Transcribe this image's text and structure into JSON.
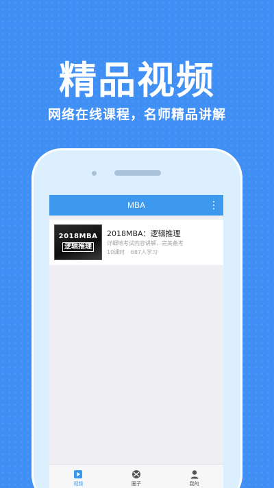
{
  "promo": {
    "headline": "精品视频",
    "subline": "网络在线课程，名师精品讲解"
  },
  "app": {
    "title": "MBA",
    "menu_icon": "more-vertical-icon",
    "colors": {
      "accent": "#3d99ee",
      "background": "#3f8ff5"
    }
  },
  "courses": [
    {
      "thumbnail_line1": "2018MBA",
      "thumbnail_line2": "逻辑推理",
      "title": "2018MBA：逻辑推理",
      "description": "详细地考试内容讲解，完美备考",
      "lessons": "10课时",
      "learners": "687人学习"
    }
  ],
  "tabs": [
    {
      "label": "视频",
      "icon": "video-play-icon",
      "active": true
    },
    {
      "label": "圈子",
      "icon": "circle-community-icon",
      "active": false
    },
    {
      "label": "我的",
      "icon": "user-profile-icon",
      "active": false
    }
  ]
}
